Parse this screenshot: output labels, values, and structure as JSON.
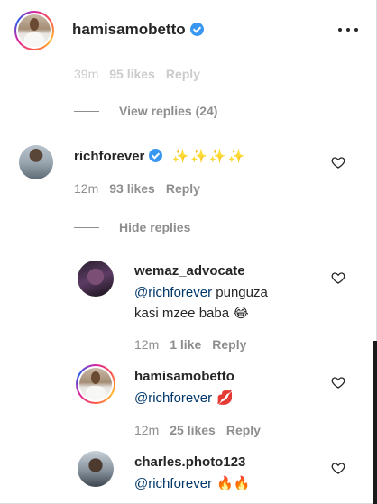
{
  "header": {
    "username": "hamisamobetto"
  },
  "top_comment_meta": {
    "time": "39m",
    "likes": "95 likes",
    "reply": "Reply"
  },
  "view_replies": "View replies (24)",
  "comment_rich": {
    "username": "richforever",
    "text": "✨✨✨✨",
    "time": "12m",
    "likes": "93 likes",
    "reply": "Reply"
  },
  "hide_replies": "Hide replies",
  "reply_wemaz": {
    "username": "wemaz_advocate",
    "mention": "@richforever",
    "text_line1": " punguza",
    "text_line2": "kasi mzee baba ",
    "emoji": "😂",
    "time": "12m",
    "likes": "1 like",
    "reply": "Reply"
  },
  "reply_hamisa": {
    "username": "hamisamobetto",
    "mention": "@richforever",
    "emoji": "💋",
    "time": "12m",
    "likes": "25 likes",
    "reply": "Reply"
  },
  "reply_charles": {
    "username": "charles.photo123",
    "mention": "@richforever",
    "emoji": "🔥🔥"
  },
  "icons": {
    "verified": "verified-badge-icon",
    "more": "more-options-icon",
    "like": "heart-icon"
  },
  "colors": {
    "link": "#00376b",
    "secondary": "#8e8e8e",
    "verified": "#3897f0"
  }
}
